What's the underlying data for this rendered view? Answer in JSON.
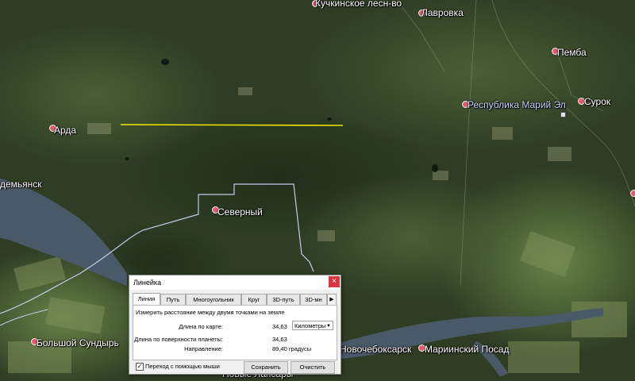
{
  "places": {
    "kuchkinskoe": "Кучкинское лесн-во",
    "lavrovka": "Лавровка",
    "pemba": "Пемба",
    "mari_el": "Республика Марий Эл",
    "surok": "Сурок",
    "arda": "Арда",
    "demyansk": "демьянск",
    "severny": "Северный",
    "bolshoy_sundyr": "Большой Сундырь",
    "novocheboksarsk": "Новочебоксарск",
    "mariinsky_posad": "Мариинский Посад",
    "novye_lapsary": "Новые Лапсары"
  },
  "ruler": {
    "title": "Линейка",
    "close": "×",
    "tabs": [
      "Линия",
      "Путь",
      "Многоугольник",
      "Круг",
      "3D-путь",
      "3D-мн"
    ],
    "tab_next": "▶",
    "description": "Измерить расстояние между двумя точками на земле",
    "map_length_label": "Длина по карте:",
    "map_length_value": "34,63",
    "unit": "Километры",
    "ground_length_label": "Длина по поверхности планеты:",
    "ground_length_value": "34,63",
    "heading_label": "Направление:",
    "heading_value": "89,40 градусы",
    "mouse_nav_label": "Переход с помощью мыши",
    "mouse_nav_checked": "✓",
    "save_label": "Сохранить",
    "clear_label": "Очистить"
  },
  "colors": {
    "measure_line": "#f2e600",
    "boundary": "#b8c0e0",
    "river": "#5a6a7a"
  }
}
